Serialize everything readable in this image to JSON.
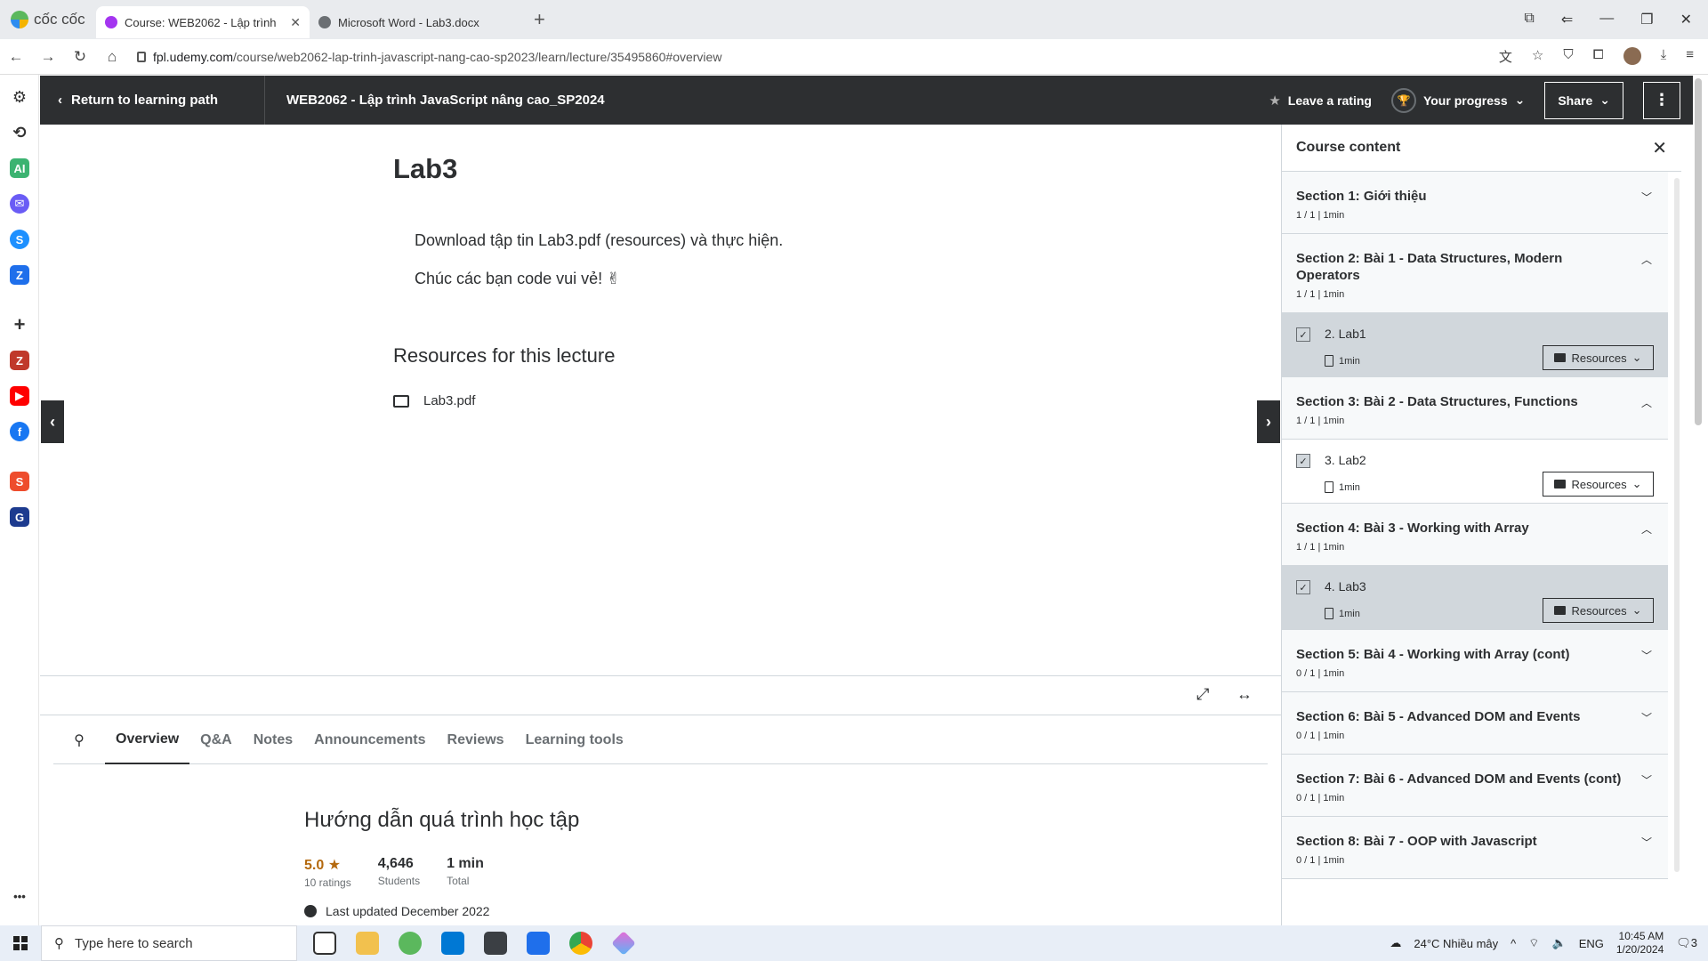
{
  "browser": {
    "brand": "cốc cốc",
    "tabs": [
      {
        "title": "Course: WEB2062 - Lập trình",
        "active": true
      },
      {
        "title": "Microsoft Word - Lab3.docx",
        "active": false
      }
    ],
    "url_host": "fpl.udemy.com",
    "url_path": "/course/web2062-lap-trinh-javascript-nang-cao-sp2023/learn/lecture/35495860#overview"
  },
  "header": {
    "back_label": "Return to learning path",
    "course_title": "WEB2062 - Lập trình JavaScript nâng cao_SP2024",
    "rating_label": "Leave a rating",
    "progress_label": "Your progress",
    "share_label": "Share"
  },
  "lecture": {
    "title": "Lab3",
    "paragraphs": [
      "Download tập tin Lab3.pdf (resources) và thực hiện.",
      "Chúc các bạn code vui vẻ! ✌"
    ],
    "resources_heading": "Resources for this lecture",
    "resource_file": "Lab3.pdf"
  },
  "tabs": [
    "Overview",
    "Q&A",
    "Notes",
    "Announcements",
    "Reviews",
    "Learning tools"
  ],
  "overview": {
    "title": "Hướng dẫn quá trình học tập",
    "rating": "5.0",
    "ratings_label": "10 ratings",
    "students": "4,646",
    "students_label": "Students",
    "total": "1 min",
    "total_label": "Total",
    "updated": "Last updated December 2022"
  },
  "course_content": {
    "title": "Course content",
    "resources_label": "Resources",
    "sections": [
      {
        "title": "Section 1: Giới thiệu",
        "meta": "1 / 1 | 1min",
        "expanded": false,
        "lessons": []
      },
      {
        "title": "Section 2: Bài 1 - Data Structures, Modern Operators",
        "meta": "1 / 1 | 1min",
        "expanded": true,
        "lessons": [
          {
            "title": "2. Lab1",
            "duration": "1min",
            "current": true
          }
        ]
      },
      {
        "title": "Section 3: Bài 2 - Data Structures, Functions",
        "meta": "1 / 1 | 1min",
        "expanded": true,
        "lessons": [
          {
            "title": "3. Lab2",
            "duration": "1min",
            "current": false
          }
        ]
      },
      {
        "title": "Section 4: Bài 3 - Working with Array",
        "meta": "1 / 1 | 1min",
        "expanded": true,
        "lessons": [
          {
            "title": "4. Lab3",
            "duration": "1min",
            "current": true
          }
        ]
      },
      {
        "title": "Section 5: Bài 4 - Working with Array (cont)",
        "meta": "0 / 1 | 1min",
        "expanded": false,
        "lessons": []
      },
      {
        "title": "Section 6: Bài 5 - Advanced DOM and Events",
        "meta": "0 / 1 | 1min",
        "expanded": false,
        "lessons": []
      },
      {
        "title": "Section 7: Bài 6 - Advanced DOM and Events (cont)",
        "meta": "0 / 1 | 1min",
        "expanded": false,
        "lessons": []
      },
      {
        "title": "Section 8: Bài 7 - OOP with Javascript",
        "meta": "0 / 1 | 1min",
        "expanded": false,
        "lessons": []
      }
    ]
  },
  "taskbar": {
    "search_placeholder": "Type here to search",
    "weather": "24°C  Nhiều mây",
    "lang": "ENG",
    "time": "10:45 AM",
    "date": "1/20/2024",
    "notif_count": "3"
  },
  "colors": {
    "udemy_dark": "#2d2f31",
    "accent": "#a435f0",
    "rating": "#b4690e"
  }
}
